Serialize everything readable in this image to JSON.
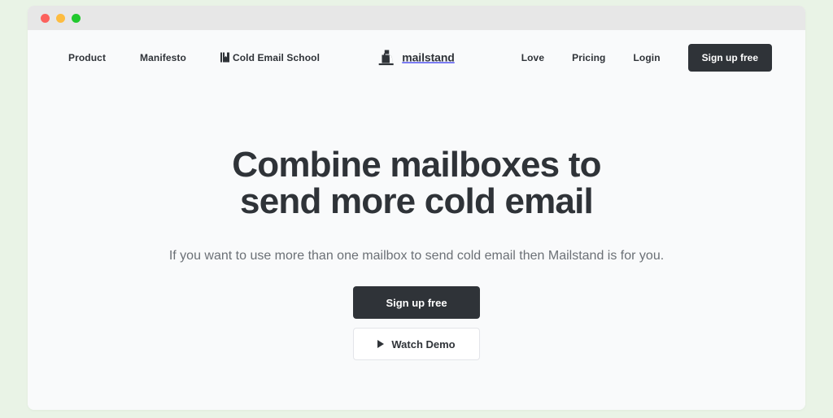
{
  "window": {
    "traffic_lights": [
      {
        "name": "close",
        "color": "#fc615d"
      },
      {
        "name": "minimize",
        "color": "#fdbc40"
      },
      {
        "name": "maximize",
        "color": "#21c92e"
      }
    ]
  },
  "colors": {
    "page_background": "#e9f3e6",
    "viewport_background": "#f9fafb",
    "titlebar": "#e7e7e7",
    "ink": "#2f3338",
    "muted": "#6b7076",
    "border": "#e3e5e9"
  },
  "header": {
    "nav_left": [
      {
        "label": "Product",
        "icon": null
      },
      {
        "label": "Manifesto",
        "icon": null
      },
      {
        "label": "Cold Email School",
        "icon": "book-icon"
      }
    ],
    "brand": {
      "name": "mailstand",
      "icon": "mailbox-icon"
    },
    "nav_right": [
      {
        "label": "Love"
      },
      {
        "label": "Pricing"
      },
      {
        "label": "Login"
      }
    ],
    "signup_button": "Sign up free"
  },
  "hero": {
    "title_line_1": "Combine mailboxes to",
    "title_line_2": "send more cold email",
    "subtitle": "If you want to use more than one mailbox to send cold email then Mailstand is for you.",
    "primary_cta": "Sign up free",
    "secondary_cta": "Watch Demo",
    "secondary_cta_icon": "play-icon"
  }
}
